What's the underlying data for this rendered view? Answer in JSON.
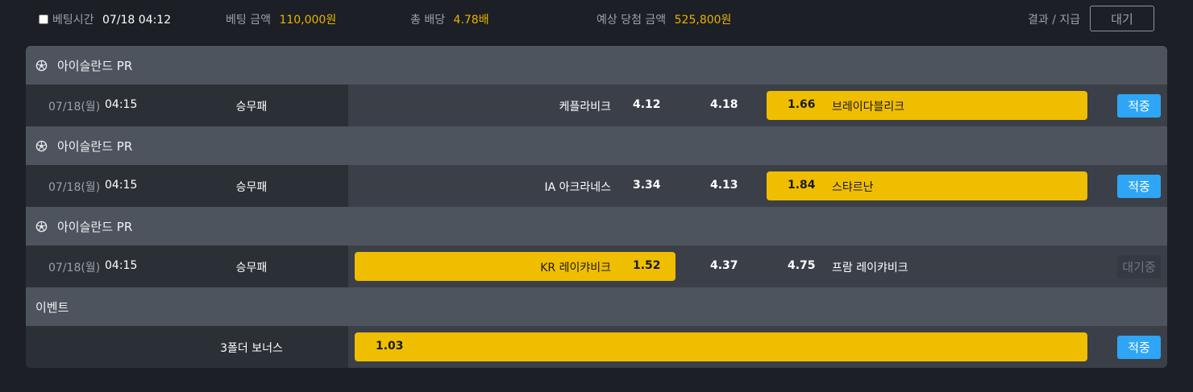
{
  "header": {
    "bet_time_label": "베팅시간",
    "bet_time_value": "07/18 04:12",
    "bet_amount_label": "베팅 금액",
    "bet_amount_value": "110,000원",
    "total_odds_label": "총 배당",
    "total_odds_value": "4.78배",
    "expected_win_label": "예상 당첨 금액",
    "expected_win_value": "525,800원",
    "result_label": "결과 / 지급",
    "result_status": "대기"
  },
  "sections": [
    {
      "league": "아이슬란드 PR",
      "date": "07/18(월)",
      "time": "04:15",
      "market": "승무패",
      "home": "케플라비크",
      "home_odds": "4.12",
      "draw_odds": "4.18",
      "away_odds": "1.66",
      "away": "브레이다블리크",
      "selected": "away",
      "status": "적중"
    },
    {
      "league": "아이슬란드 PR",
      "date": "07/18(월)",
      "time": "04:15",
      "market": "승무패",
      "home": "IA 아크라네스",
      "home_odds": "3.34",
      "draw_odds": "4.13",
      "away_odds": "1.84",
      "away": "스탸르난",
      "selected": "away",
      "status": "적중"
    },
    {
      "league": "아이슬란드 PR",
      "date": "07/18(월)",
      "time": "04:15",
      "market": "승무패",
      "home": "KR 레이캬비크",
      "home_odds": "1.52",
      "draw_odds": "4.37",
      "away_odds": "4.75",
      "away": "프람 레이캬비크",
      "selected": "home",
      "status": "대기중"
    }
  ],
  "event": {
    "title": "이벤트",
    "name": "3폴더 보너스",
    "odds": "1.03",
    "status": "적중"
  },
  "colors": {
    "highlight": "#f0be00",
    "win_badge": "#2ea6f5",
    "gold_text": "#e8b400"
  }
}
